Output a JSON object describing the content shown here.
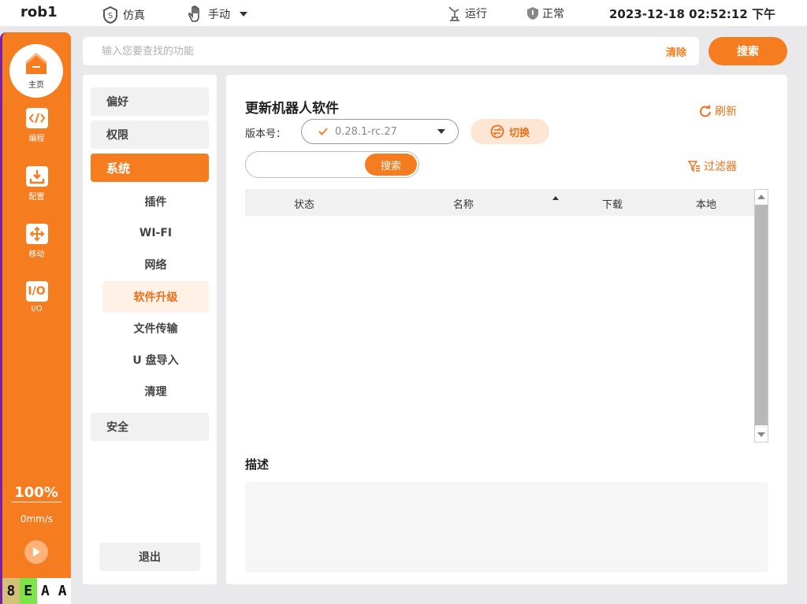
{
  "topbar": {
    "robot_name": "rob1",
    "mode_sim": "仿真",
    "mode_manual": "手动",
    "run_state": "运行",
    "health": "正常",
    "datetime": "2023-12-18 02:52:12 下午"
  },
  "rail": {
    "home": "主页",
    "items": [
      {
        "label": "编程",
        "icon": "code-icon"
      },
      {
        "label": "配置",
        "icon": "config-icon"
      },
      {
        "label": "移动",
        "icon": "move-icon"
      },
      {
        "label": "I/O",
        "icon": "io-icon",
        "glyph": "I/O"
      }
    ],
    "speed_percent": "100%",
    "speed_value": "0mm/s",
    "status_codes": [
      "8",
      "E",
      "A",
      "A"
    ],
    "status_colors": [
      "#d4c079",
      "#7ee34a",
      "#ffffff",
      "#ffffff"
    ]
  },
  "search": {
    "placeholder": "输入您要查找的功能",
    "clear_label": "清除",
    "button_label": "搜索"
  },
  "nav": {
    "categories": [
      "偏好",
      "权限",
      "系统"
    ],
    "active_category": "系统",
    "sub_items": [
      "插件",
      "WI-FI",
      "网络",
      "软件升级",
      "文件传输",
      "U 盘导入",
      "清理"
    ],
    "active_sub": "软件升级",
    "security": "安全",
    "logout": "退出"
  },
  "content": {
    "title": "更新机器人软件",
    "refresh_label": "刷新",
    "version_label": "版本号：",
    "version_value": "0.28.1-rc.27",
    "switch_label": "切换",
    "search_button": "搜索",
    "filter_label": "过滤器",
    "columns": [
      "状态",
      "名称",
      "下载",
      "本地"
    ],
    "rows": [],
    "description_title": "描述",
    "description_text": ""
  },
  "colors": {
    "accent": "#f57c1f",
    "accent_light": "#fde6d4"
  }
}
